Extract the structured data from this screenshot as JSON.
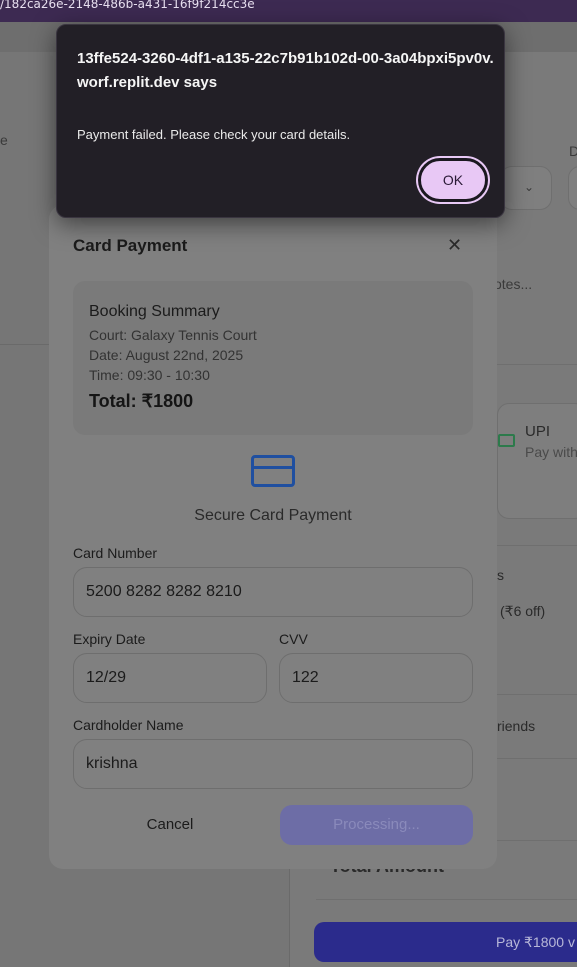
{
  "browser": {
    "url_fragment": "/182ca26e-2148-486b-a431-16f9f214cc3e"
  },
  "background": {
    "left_letter": "e",
    "right_letter": "D",
    "notes_placeholder": "otes...",
    "upi_label": "UPI",
    "upi_sub": "Pay with",
    "partial_s": "s",
    "discount_text": "(₹6 off)",
    "friends_text": "riends",
    "total_amount_label": "Total Amount",
    "pay_button_label": "Pay ₹1800 v"
  },
  "modal": {
    "title": "Card Payment",
    "close_symbol": "✕",
    "summary": {
      "title": "Booking Summary",
      "court": "Court: Galaxy Tennis Court",
      "date": "Date: August 22nd, 2025",
      "time": "Time: 09:30 - 10:30",
      "total": "Total: ₹1800"
    },
    "secure_label": "Secure Card Payment",
    "card_number_label": "Card Number",
    "card_number_value": "5200 8282 8282 8210",
    "expiry_label": "Expiry Date",
    "expiry_value": "12/29",
    "cvv_label": "CVV",
    "cvv_value": "122",
    "cardholder_label": "Cardholder Name",
    "cardholder_value": "krishna",
    "cancel_label": "Cancel",
    "processing_label": "Processing..."
  },
  "alert": {
    "origin": "13ffe524-3260-4df1-a135-22c7b91b102d-00-3a04bpxi5pv0v.worf.replit.dev says",
    "message": "Payment failed. Please check your card details.",
    "ok_label": "OK"
  }
}
